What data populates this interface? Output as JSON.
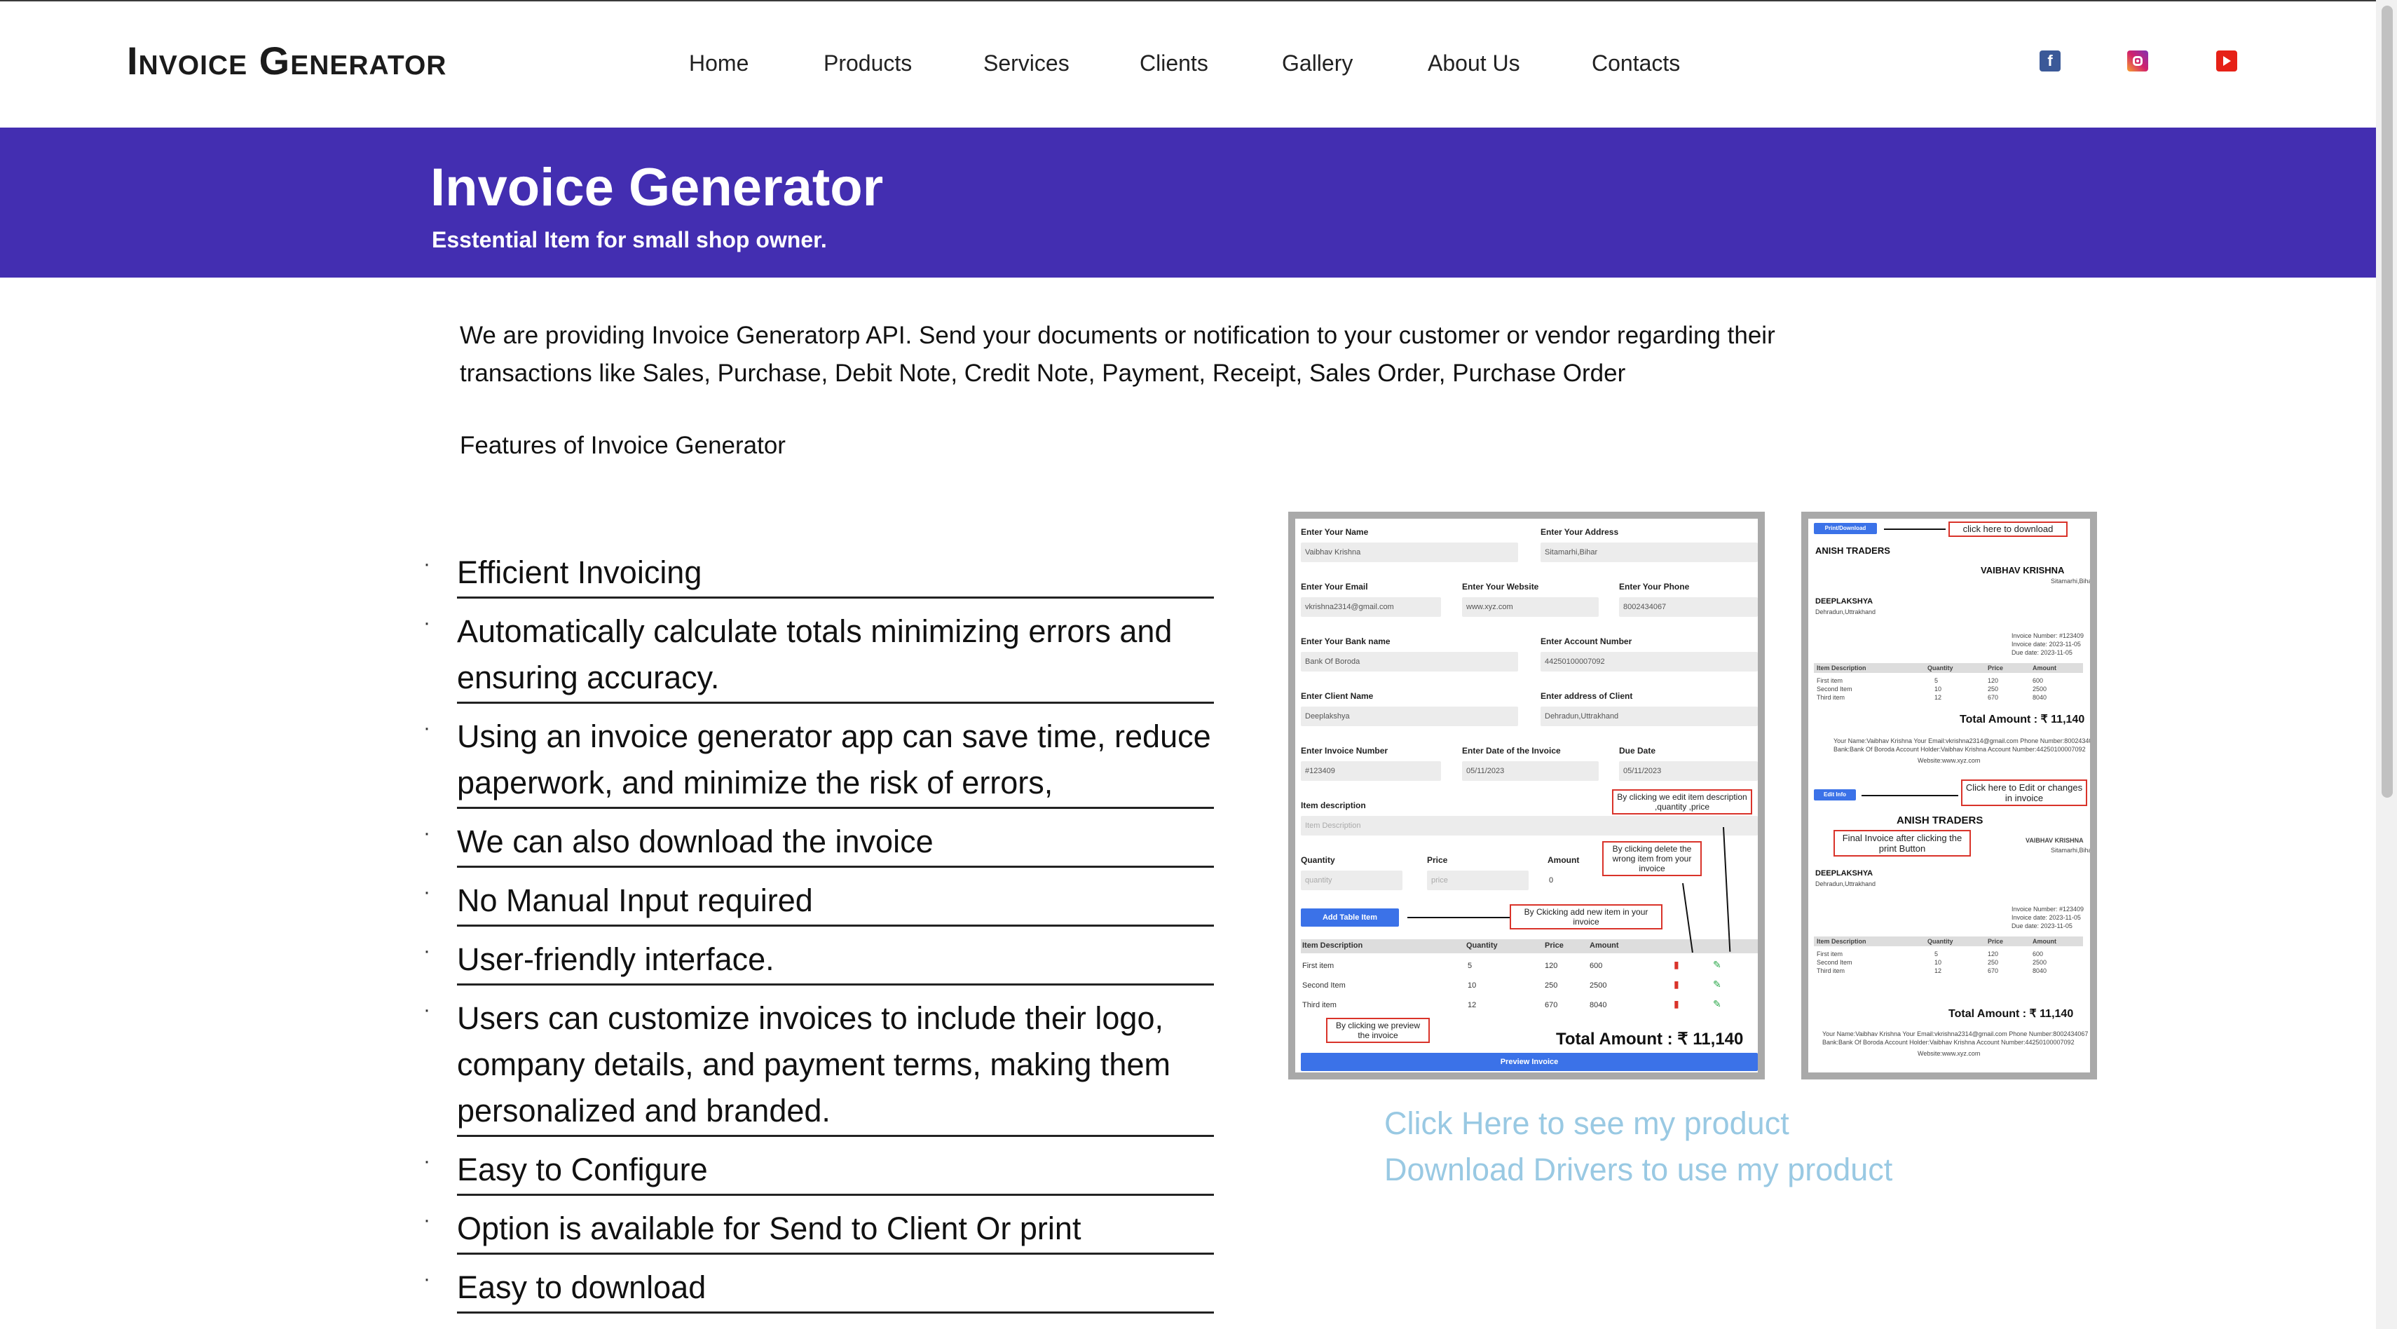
{
  "header": {
    "logo": "Invoice Generator",
    "nav": [
      "Home",
      "Products",
      "Services",
      "Clients",
      "Gallery",
      "About Us",
      "Contacts"
    ],
    "social_icons": [
      "facebook-icon",
      "instagram-icon",
      "youtube-icon"
    ]
  },
  "banner": {
    "title": "Invoice Generator",
    "subtitle": "Esstential Item for small shop owner.",
    "background_color": "#432eb1"
  },
  "intro": {
    "text": "We are providing Invoice Generatorp API. Send your documents or notification to your customer or vendor regarding their transactions like Sales, Purchase, Debit Note, Credit Note, Payment, Receipt, Sales Order, Purchase Order"
  },
  "features": {
    "heading": "Features of Invoice Generator",
    "items": [
      "Efficient Invoicing",
      "Automatically calculate totals minimizing errors and ensuring accuracy.",
      "Using an invoice generator app can save time, reduce paperwork, and minimize the risk of errors,",
      "We can also download the invoice",
      "No Manual Input required",
      "User-friendly interface.",
      "Users can customize invoices to include their logo, company details, and payment terms, making them personalized and branded.",
      "Easy to Configure",
      "Option is available for Send to Client Or print",
      "Easy to download"
    ]
  },
  "form_screenshot": {
    "labels": {
      "name": "Enter Your Name",
      "address": "Enter Your Address",
      "email": "Enter Your Email",
      "website": "Enter Your Website",
      "phone": "Enter Your Phone",
      "bank": "Enter Your Bank name",
      "account": "Enter Account Number",
      "client_name": "Enter Client Name",
      "client_address": "Enter address of Client",
      "invoice_number": "Enter Invoice Number",
      "invoice_date": "Enter Date of the Invoice",
      "due_date": "Due Date",
      "item_description": "Item description",
      "quantity": "Quantity",
      "price": "Price",
      "amount": "Amount"
    },
    "values": {
      "name": "Vaibhav Krishna",
      "address": "Sitamarhi,Bihar",
      "email": "vkrishna2314@gmail.com",
      "website": "www.xyz.com",
      "phone": "8002434067",
      "bank": "Bank Of Boroda",
      "account": "44250100007092",
      "client_name": "Deeplakshya",
      "client_address": "Dehradun,Uttrakhand",
      "invoice_number": "#123409",
      "invoice_date": "05/11/2023",
      "due_date": "05/11/2023",
      "item_description_placeholder": "Item Description",
      "quantity_placeholder": "quantity",
      "price_placeholder": "price",
      "amount": "0"
    },
    "add_button": "Add Table Item",
    "preview_button": "Preview Invoice",
    "table_headers": [
      "Item Description",
      "Quantity",
      "Price",
      "Amount"
    ],
    "rows": [
      [
        "First item",
        "5",
        "120",
        "600"
      ],
      [
        "Second Item",
        "10",
        "250",
        "2500"
      ],
      [
        "Third item",
        "12",
        "670",
        "8040"
      ]
    ],
    "total": "Total Amount : ₹ 11,140",
    "callouts": {
      "edit": "By clicking we edit item description ,quantity ,price",
      "delete": "By clicking delete the wrong item from your invoice",
      "add": "By Ckicking  add new item in your invoice",
      "preview": "By clicking we preview the invoice"
    }
  },
  "invoice_screenshot": {
    "print_button": "Print/Download",
    "edit_button": "Edit Info",
    "company": "ANISH TRADERS",
    "owner": "VAIBHAV KRISHNA",
    "owner_city": "Sitamarhi,Bihar",
    "client": "DEEPLAKSHYA",
    "client_city": "Dehradun,Uttrakhand",
    "meta": [
      "Invoice Number: #123409",
      "Invoice date: 2023-11-05",
      "Due date: 2023-11-05"
    ],
    "total": "Total Amount : ₹ 11,140",
    "footer1": "Your Name:Vaibhav Krishna Your Email:vkrishna2314@gmail.com Phone Number:8002434067",
    "footer2": "Bank:Bank Of Boroda Account Holder:Vaibhav Krishna Account Number:44250100007092",
    "footer3": "Website:www.xyz.com",
    "callouts": {
      "download": "click here to download",
      "edit": "Click here to Edit or changes in invoice",
      "final": "Final Invoice after clicking the print Button"
    }
  },
  "links": {
    "see_product": "Click Here to see my product",
    "download_drivers": "Download Drivers to use my product",
    "color": "#99c9e3"
  }
}
